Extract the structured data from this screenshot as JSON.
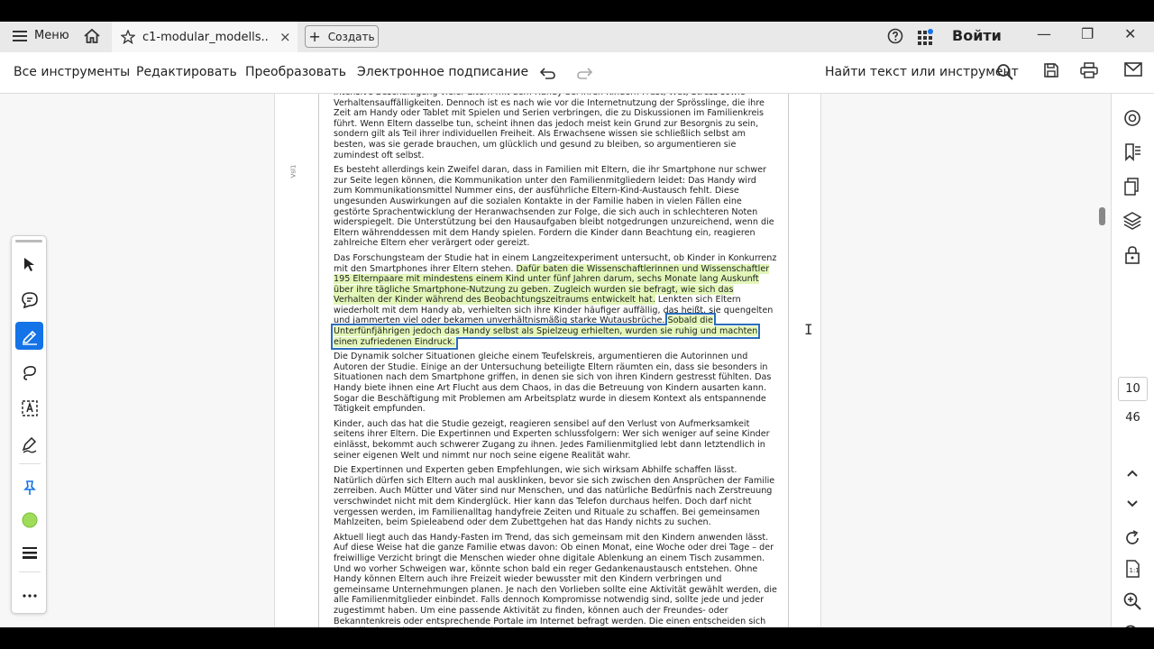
{
  "tabbar": {
    "menu_label": "Меню",
    "tab_title": "c1-modular_modells...",
    "tab_close": "×",
    "create_label": "Создать",
    "signin_label": "Войти",
    "minimize": "—",
    "maximize": "❐",
    "close": "✕"
  },
  "toolbar": {
    "all_tools": "Все инструменты",
    "edit": "Редактировать",
    "convert": "Преобразовать",
    "esign": "Электронное подписание",
    "find_label": "Найти текст или инструмент"
  },
  "document": {
    "side_mark": "Vsl1",
    "p1": "intensive Beschäftigung vieler Eltern mit dem Handy bei ihren Kindern Frust, Wut, Stress sowie Verhaltensauffälligkeiten. Dennoch ist es nach wie vor die Internetnutzung der Sprösslinge, die ihre Zeit am Handy oder Tablet mit Spielen und Serien verbringen, die zu Diskussionen im Familienkreis führt. Wenn Eltern dasselbe tun, scheint ihnen das jedoch meist kein Grund zur Besorgnis zu sein, sondern gilt als Teil ihrer individuellen Freiheit. Als Erwachsene wissen sie schließlich selbst am besten, was sie gerade brauchen, um glücklich und gesund zu bleiben, so argumentieren sie zumindest oft selbst.",
    "p2": "Es besteht allerdings kein Zweifel daran, dass in Familien mit Eltern, die ihr Smartphone nur schwer zur Seite legen können, die Kommunikation unter den Familienmitgliedern leidet: Das Handy wird zum Kommunikationsmittel Nummer eins, der ausführliche Eltern-Kind-Austausch fehlt. Diese ungesunden Auswirkungen auf die sozialen Kontakte in der Familie haben in vielen Fällen eine gestörte Sprachentwicklung der Heranwachsenden zur Folge, die sich auch in schlechteren Noten widerspiegelt. Die Unterstützung bei den Hausaufgaben bleibt notgedrungen unzureichend, wenn die Eltern währenddessen mit dem Handy spielen. Fordern die Kinder dann Beachtung ein, reagieren zahlreiche Eltern eher verärgert oder gereizt.",
    "p3a": "Das Forschungsteam der Studie hat in einem Langzeitexperiment untersucht, ob Kinder in Konkurrenz mit den Smartphones ihrer Eltern stehen. ",
    "p3b": "Dafür baten die Wissenschaftlerinnen und Wissenschaftler 195 Elternpaare mit mindestens einem Kind unter fünf Jahren darum, sechs Monate lang Auskunft über ihre tägliche Smartphone-Nutzung zu geben. Zugleich wurden sie befragt, wie sich das Verhalten der Kinder während des Beobachtungszeitraums entwickelt hat.",
    "p3c": " Lenkten sich Eltern wiederholt mit dem Handy ab, verhielten sich ihre Kinder häufiger auffällig, das heißt, sie quengelten und jammerten viel oder bekamen unverhältnismäßig starke Wutausbrüche. ",
    "p3d": "Sobald die Unterfünfjährigen jedoch das Handy selbst als Spielzeug erhielten, wurden sie ruhig und machten einen zufriedenen Eindruck.",
    "p4": "Die Dynamik solcher Situationen gleiche einem Teufelskreis, argumentieren die Autorinnen und Autoren der Studie. Einige an der Untersuchung beteiligte Eltern räumten ein, dass sie besonders in Situationen nach dem Smartphone griffen, in denen sie sich von ihren Kindern gestresst fühlten. Das Handy biete ihnen eine Art Flucht aus dem Chaos, in das die Betreuung von Kindern ausarten kann. Sogar die Beschäftigung mit Problemen am Arbeitsplatz wurde in diesem Kontext als entspannende Tätigkeit empfunden.",
    "p5": "Kinder, auch das hat die Studie gezeigt, reagieren sensibel auf den Verlust von Aufmerksamkeit seitens ihrer Eltern. Die Expertinnen und Experten schlussfolgern: Wer sich weniger auf seine Kinder einlässt, bekommt auch schwerer Zugang zu ihnen. Jedes Familienmitglied lebt dann letztendlich in seiner eigenen Welt und nimmt nur noch seine eigene Realität wahr.",
    "p6": "Die Expertinnen und Experten geben Empfehlungen, wie sich wirksam Abhilfe schaffen lässt. Natürlich dürfen sich Eltern auch mal ausklinken, bevor sie sich zwischen den Ansprüchen der Familie zerreiben. Auch Mütter und Väter sind nur Menschen, und das natürliche Bedürfnis nach Zerstreuung verschwindet nicht mit dem Kinderglück. Hier kann das Telefon durchaus helfen. Doch darf nicht vergessen werden, im Familienalltag handyfreie Zeiten und Rituale zu schaffen. Bei gemeinsamen Mahlzeiten, beim Spieleabend oder dem Zubettgehen hat das Handy nichts zu suchen.",
    "p7": "Aktuell liegt auch das Handy-Fasten im Trend, das sich gemeinsam mit den Kindern anwenden lässt. Auf diese Weise hat die ganze Familie etwas davon: Ob einen Monat, eine Woche oder drei Tage – der freiwillige Verzicht bringt die Menschen wieder ohne digitale Ablenkung an einem Tisch zusammen. Und wo vorher Schweigen war, könnte schon bald ein reger Gedankenaustausch entstehen. Ohne Handy können Eltern auch ihre Freizeit wieder bewusster mit den Kindern verbringen und gemeinsame Unternehmungen planen. Je nach den Vorlieben sollte eine Aktivität gewählt werden, die alle Familienmitglieder einbindet. Falls dennoch Kompromisse notwendig sind, sollte jede und jeder zugestimmt haben. Um eine passende Aktivität zu finden, können auch der Freundes- oder Bekanntenkreis oder entsprechende Portale im Internet befragt werden. Die einen entscheiden sich dann für das Anlegen eines Gemüsebeets im Gemeinschaftsgarten, die anderen für eine Schnitzeljagd durch die Stadt – alles ist erlaubt, Hauptsache, es macht Spaß und das Handy wird nur für Fotos aus der Tasche genommen."
  },
  "pagination": {
    "current_page": "10",
    "total_pages": "46"
  },
  "colors": {
    "accent": "#1473e6",
    "highlight": "#e3f7b9",
    "selection_border": "#2a6ebb",
    "color_swatch": "#9edc5a"
  },
  "icons": [
    "menu-icon",
    "home-icon",
    "star-icon",
    "help-icon",
    "apps-icon",
    "undo-icon",
    "redo-icon",
    "search-icon",
    "save-icon",
    "print-icon",
    "mail-icon"
  ]
}
